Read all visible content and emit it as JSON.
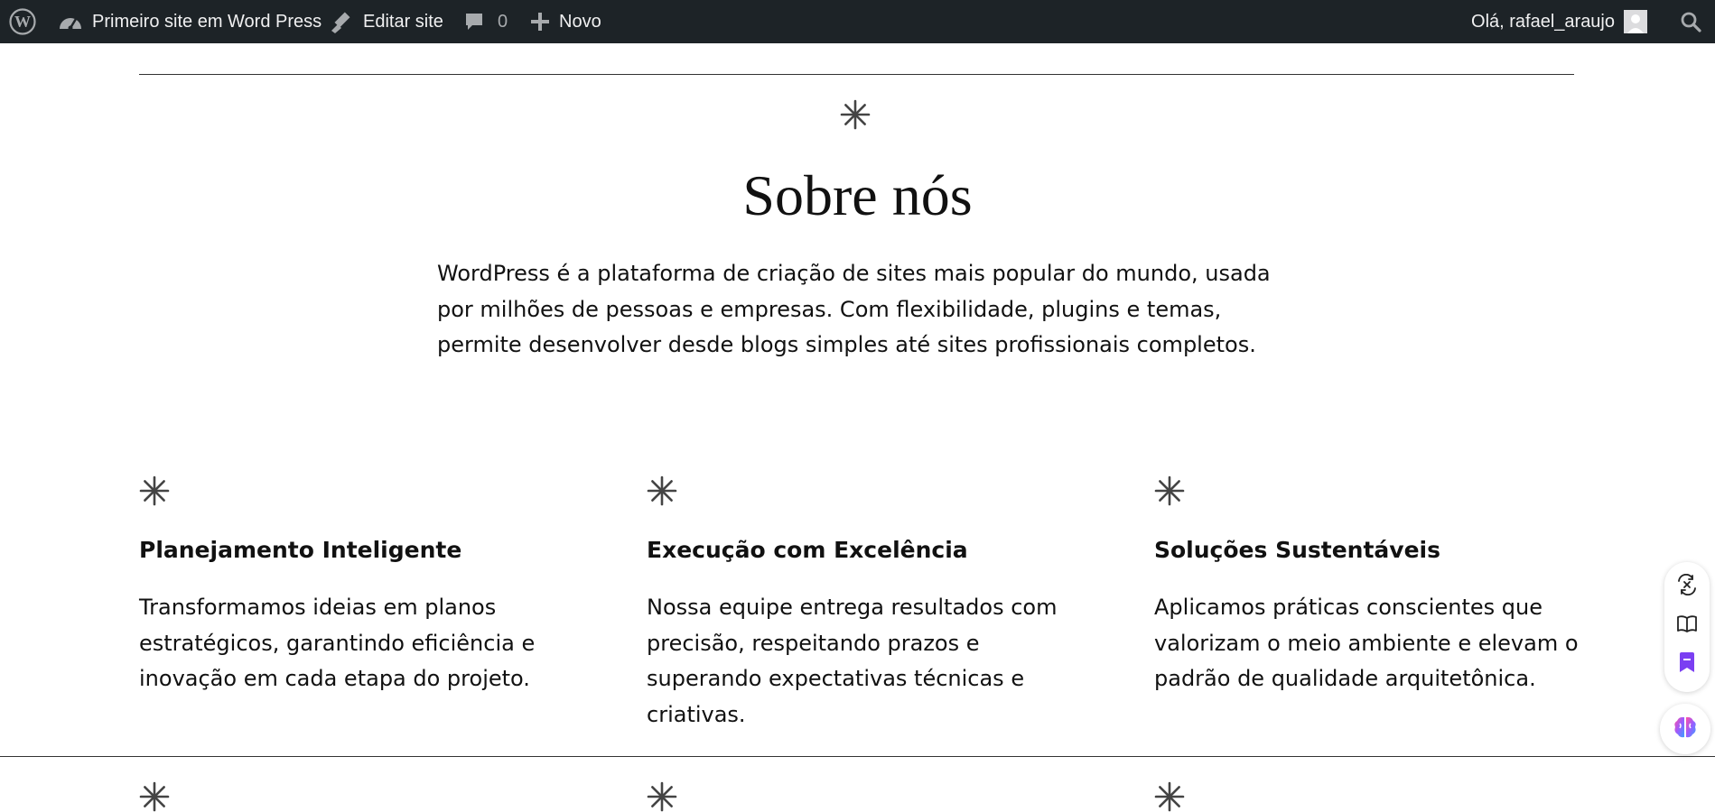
{
  "admin_bar": {
    "site_name": "Primeiro site em Word Press",
    "edit_site": "Editar site",
    "comments_count": "0",
    "new_label": "Novo",
    "greeting": "Olá, rafael_araujo"
  },
  "about": {
    "title": "Sobre nós",
    "intro": "WordPress é a plataforma de criação de sites mais popular do mundo, usada por milhões de pessoas e empresas. Com flexibilidade, plugins e temas, permite desenvolver desde blogs simples até sites profissionais completos."
  },
  "features": [
    {
      "title": "Planejamento Inteligente",
      "text": "Transformamos ideias em planos estratégicos, garantindo eficiência e inovação em cada etapa do projeto."
    },
    {
      "title": "Execução com Excelência",
      "text": "Nossa equipe entrega resultados com precisão, respeitando prazos e superando expectativas técnicas e criativas."
    },
    {
      "title": "Soluções Sustentáveis",
      "text": "Aplicamos práticas conscientes que valorizam o meio ambiente e elevam o padrão de qualidade arquitetônica."
    }
  ],
  "icons": {
    "admin_bar": [
      "wordpress-logo-icon",
      "dashboard-icon",
      "edit-icon",
      "comment-icon",
      "plus-icon",
      "avatar",
      "search-icon"
    ],
    "content": "asterisk-icon",
    "side_toolbar": [
      "translate-icon",
      "book-icon",
      "bookmark-icon",
      "ai-brain-icon"
    ]
  },
  "colors": {
    "admin_bar_bg": "#1d2327",
    "admin_bar_text": "#f0f0f1",
    "text": "#111111",
    "accent_purple": "#7b3ff2"
  }
}
